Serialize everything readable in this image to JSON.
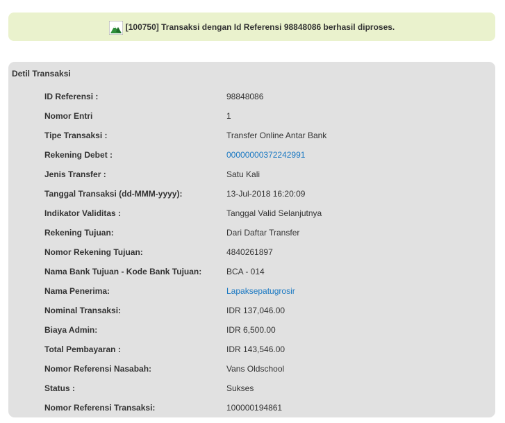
{
  "notice": {
    "message": "[100750] Transaksi dengan Id Referensi 98848086 berhasil diproses.",
    "icon": "success-mountain-icon",
    "background": "#eaf2cd"
  },
  "panel": {
    "title": "Detil Transaksi",
    "background": "#e1e1e1",
    "link_color": "#1a78c2"
  },
  "rows": [
    {
      "label": "ID Referensi :",
      "value": "98848086",
      "link": false
    },
    {
      "label": "Nomor Entri",
      "value": "1",
      "link": false
    },
    {
      "label": "Tipe Transaksi :",
      "value": "Transfer Online Antar Bank",
      "link": false
    },
    {
      "label": "Rekening Debet :",
      "value": "00000000372242991",
      "link": true
    },
    {
      "label": "Jenis Transfer :",
      "value": "Satu Kali",
      "link": false
    },
    {
      "label": "Tanggal Transaksi (dd-MMM-yyyy):",
      "value": "13-Jul-2018 16:20:09",
      "link": false
    },
    {
      "label": "Indikator Validitas :",
      "value": "Tanggal Valid Selanjutnya",
      "link": false
    },
    {
      "label": "Rekening Tujuan:",
      "value": "Dari Daftar Transfer",
      "link": false
    },
    {
      "label": "Nomor Rekening Tujuan:",
      "value": "4840261897",
      "link": false
    },
    {
      "label": "Nama Bank Tujuan - Kode Bank Tujuan:",
      "value": "BCA - 014",
      "link": false
    },
    {
      "label": "Nama Penerima:",
      "value": "Lapaksepatugrosir",
      "link": true
    },
    {
      "label": "Nominal Transaksi:",
      "value": "IDR 137,046.00",
      "link": false
    },
    {
      "label": "Biaya Admin:",
      "value": "IDR 6,500.00",
      "link": false
    },
    {
      "label": "Total Pembayaran :",
      "value": "IDR 143,546.00",
      "link": false
    },
    {
      "label": "Nomor Referensi Nasabah:",
      "value": "Vans Oldschool",
      "link": false
    },
    {
      "label": "Status :",
      "value": "Sukses",
      "link": false
    },
    {
      "label": "Nomor Referensi Transaksi:",
      "value": "100000194861",
      "link": false
    }
  ]
}
